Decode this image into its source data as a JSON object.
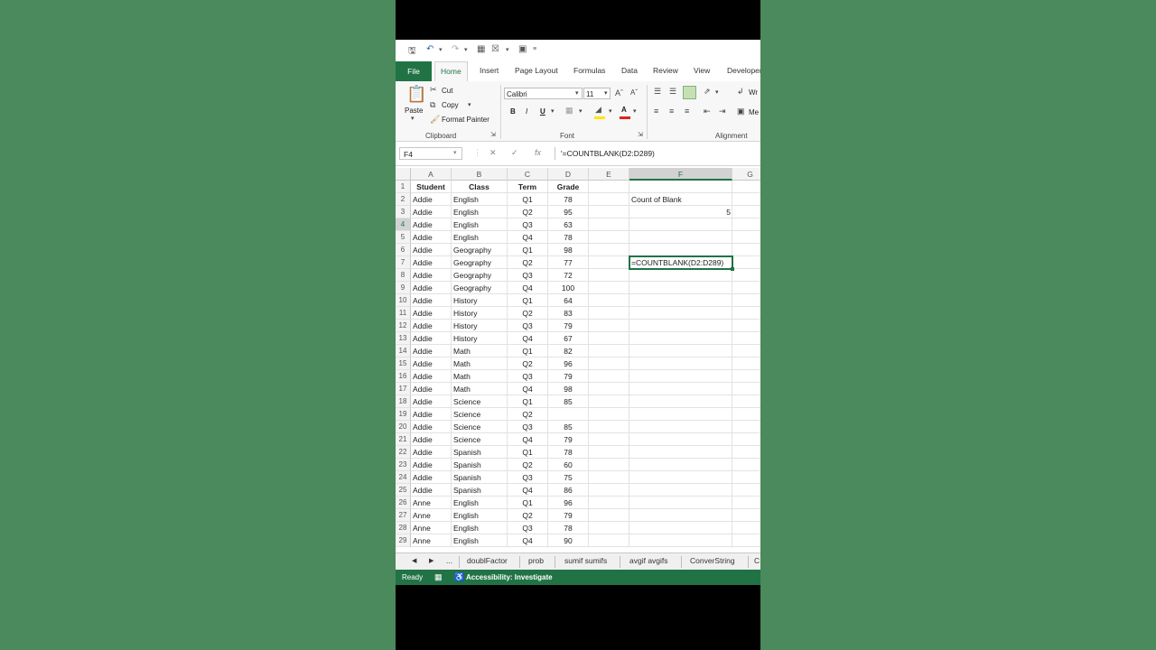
{
  "tabs": [
    "File",
    "Home",
    "Insert",
    "Page Layout",
    "Formulas",
    "Data",
    "Review",
    "View",
    "Developer"
  ],
  "clipboard": {
    "paste": "Paste",
    "cut": "Cut",
    "copy": "Copy",
    "format_painter": "Format Painter",
    "label": "Clipboard"
  },
  "font": {
    "name": "Calibri",
    "size": "11",
    "bold": "B",
    "italic": "I",
    "underline": "U",
    "label": "Font"
  },
  "alignment": {
    "label": "Alignment",
    "wrap": "Wr",
    "merge": "Me"
  },
  "formula_bar": {
    "name_box": "F4",
    "formula": "'=COUNTBLANK(D2:D289)"
  },
  "columns": [
    "A",
    "B",
    "C",
    "D",
    "E",
    "F",
    "G"
  ],
  "selected_column": "F",
  "selected_row": "4",
  "headers": {
    "student": "Student",
    "class": "Class",
    "term": "Term",
    "grade": "Grade"
  },
  "rows": [
    [
      "Addie",
      "English",
      "Q1",
      "78"
    ],
    [
      "Addie",
      "English",
      "Q2",
      "95"
    ],
    [
      "Addie",
      "English",
      "Q3",
      "63"
    ],
    [
      "Addie",
      "English",
      "Q4",
      "78"
    ],
    [
      "Addie",
      "Geography",
      "Q1",
      "98"
    ],
    [
      "Addie",
      "Geography",
      "Q2",
      "77"
    ],
    [
      "Addie",
      "Geography",
      "Q3",
      "72"
    ],
    [
      "Addie",
      "Geography",
      "Q4",
      "100"
    ],
    [
      "Addie",
      "History",
      "Q1",
      "64"
    ],
    [
      "Addie",
      "History",
      "Q2",
      "83"
    ],
    [
      "Addie",
      "History",
      "Q3",
      "79"
    ],
    [
      "Addie",
      "History",
      "Q4",
      "67"
    ],
    [
      "Addie",
      "Math",
      "Q1",
      "82"
    ],
    [
      "Addie",
      "Math",
      "Q2",
      "96"
    ],
    [
      "Addie",
      "Math",
      "Q3",
      "79"
    ],
    [
      "Addie",
      "Math",
      "Q4",
      "98"
    ],
    [
      "Addie",
      "Science",
      "Q1",
      "85"
    ],
    [
      "Addie",
      "Science",
      "Q2",
      ""
    ],
    [
      "Addie",
      "Science",
      "Q3",
      "85"
    ],
    [
      "Addie",
      "Science",
      "Q4",
      "79"
    ],
    [
      "Addie",
      "Spanish",
      "Q1",
      "78"
    ],
    [
      "Addie",
      "Spanish",
      "Q2",
      "60"
    ],
    [
      "Addie",
      "Spanish",
      "Q3",
      "75"
    ],
    [
      "Addie",
      "Spanish",
      "Q4",
      "86"
    ],
    [
      "Anne",
      "English",
      "Q1",
      "96"
    ],
    [
      "Anne",
      "English",
      "Q2",
      "79"
    ],
    [
      "Anne",
      "English",
      "Q3",
      "78"
    ],
    [
      "Anne",
      "English",
      "Q4",
      "90"
    ]
  ],
  "side": {
    "count_label": "Count of Blank",
    "count_value": "5",
    "edit_text": "=COUNTBLANK(D2:D289)"
  },
  "sheet_tabs": [
    "...",
    "doublFactor",
    "prob",
    "sumif sumifs",
    "avgif avgifs",
    "ConverString",
    "C"
  ],
  "status": {
    "ready": "Ready",
    "accessibility": "Accessibility: Investigate"
  },
  "colors": {
    "accent": "#217346",
    "backdrop": "#4a8a5c"
  }
}
